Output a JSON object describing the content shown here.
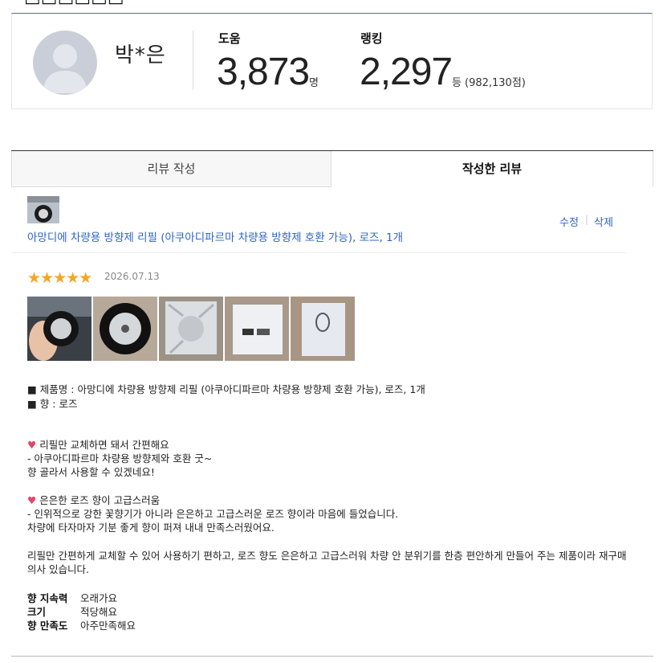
{
  "profile": {
    "name": "박*은",
    "help_label": "도움",
    "help_count": "3,873",
    "help_unit": "명",
    "rank_label": "랭킹",
    "rank_value": "2,297",
    "rank_unit": "등",
    "rank_points": "(982,130점)"
  },
  "tabs": [
    {
      "label": "리뷰 작성"
    },
    {
      "label": "작성한 리뷰"
    }
  ],
  "review": {
    "product_title": "아망디에 차량용 방향제 리필 (아쿠아디파르마 차량용 방향제 호환 가능), 로즈, 1개",
    "edit_label": "수정",
    "delete_label": "삭제",
    "separator": "|",
    "rating": 5,
    "stars": "★★★★★",
    "date": "2026.07.13",
    "lines": [
      "■ 제품명 : 아망디에 차량용 방향제 리필 (아쿠아디파르마 차량용 방향제 호환 가능), 로즈, 1개",
      "■ 향 : 로즈",
      "리필만 교체하면 돼서 간편해요",
      "- 아쿠아디파르마 차량용 방향제와 호환 굿~",
      "향 골라서 사용할 수 있겠네요!",
      "은은한 로즈 향이 고급스러움",
      "- 인위적으로 강한 꽃향기가 아니라 은은하고 고급스러운 로즈 향이라 마음에 들었습니다.",
      "차량에 타자마자 기분 좋게 향이 퍼져  내내 만족스러웠어요.",
      "리필만 간편하게 교체할 수 있어 사용하기 편하고, 로즈 향도 은은하고 고급스러워 차량 안 분위기를 한층 편안하게 만들어 주는 제품이라 재구매",
      "의사 있습니다."
    ],
    "attributes": [
      {
        "key": "향 지속력",
        "value": "오래가요"
      },
      {
        "key": "크기",
        "value": "적당해요"
      },
      {
        "key": "향 만족도",
        "value": "아주만족해요"
      }
    ]
  }
}
